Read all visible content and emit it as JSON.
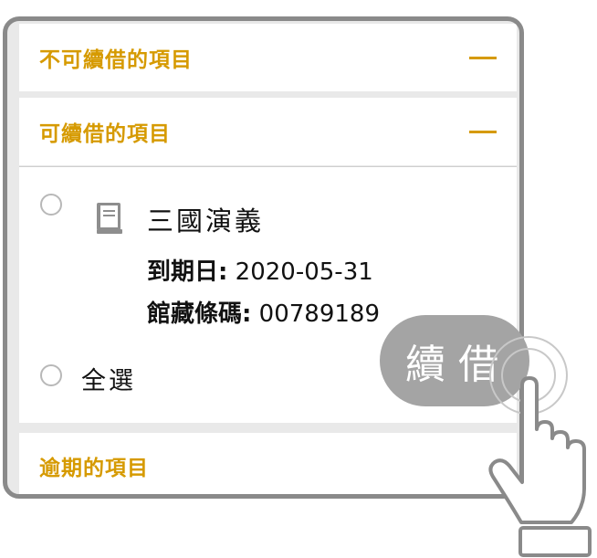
{
  "sections": {
    "non_renewable": {
      "title": "不可續借的項目"
    },
    "renewable": {
      "title": "可續借的項目"
    },
    "overdue": {
      "title": "逾期的項目"
    }
  },
  "item": {
    "title": "三國演義",
    "due_label": "到期日:",
    "due_value": "2020-05-31",
    "barcode_label": "館藏條碼:",
    "barcode_value": "00789189"
  },
  "select_all_label": "全選",
  "renew_button_label": "續借",
  "colors": {
    "accent": "#d69a00",
    "button": "#a4a4a4",
    "border": "#8a8a8a"
  }
}
